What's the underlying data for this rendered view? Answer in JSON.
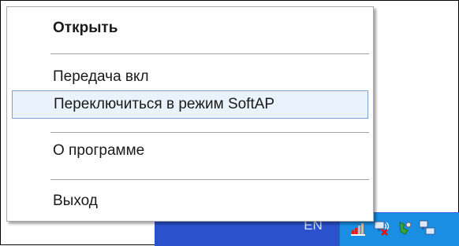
{
  "menu": {
    "items": [
      {
        "label": "Открыть",
        "default": true
      },
      {
        "label": "Передача вкл"
      },
      {
        "label": "Переключиться в режим SoftAP",
        "highlighted": true
      },
      {
        "label": "О программе"
      },
      {
        "label": "Выход"
      }
    ]
  },
  "taskbar": {
    "language": "EN",
    "tray_icons": [
      "signal-bars-icon",
      "network-disconnected-icon",
      "safely-remove-hardware-icon",
      "network-connections-icon"
    ]
  },
  "colors": {
    "taskbar": "#2a52cd",
    "tray": "#1a8ee3",
    "highlight_fill": "#eaf3fb",
    "highlight_border": "#7da2ce"
  }
}
